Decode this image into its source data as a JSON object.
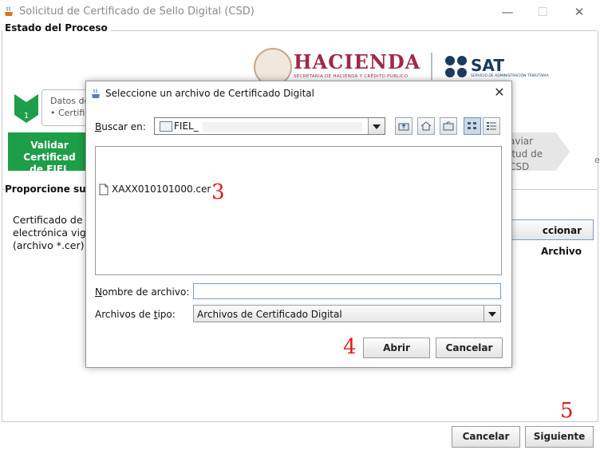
{
  "window": {
    "title": "Solicitud de Certificado de Sello Digital (CSD)",
    "minimize": "—",
    "maximize": "☐",
    "close": "✕"
  },
  "main": {
    "process_header": "Estado del Proceso",
    "logo_hacienda": "HACIENDA",
    "logo_hacienda_sub": "SECRETARÍA DE HACIENDA Y CRÉDITO PÚBLICO",
    "logo_sat": "SAT",
    "logo_sat_sub": "SERVICIO DE ADMINISTRACIÓN TRIBUTARIA",
    "step_number": "1",
    "step_info_line1": "Datos de",
    "step_info_line2": "•  Certifi",
    "green_step_line1": "Validar Certificad",
    "green_step_line2": "de FIEL Vigente",
    "gray_step_line1": "aviar",
    "gray_step_line2": "itud de",
    "gray_step_line3": "CSD",
    "edge_letter": "e",
    "provide_header": "Proporcione su ce",
    "cert_label_line1": "Certificado de fi",
    "cert_label_line2": "electrónica vige",
    "cert_label_line3": "(archivo *.cer)",
    "select_file_button": "ccionar Archivo",
    "cancel_button": "Cancelar",
    "next_button": "Siguiente",
    "annotation_5": "5"
  },
  "dialog": {
    "title": "Seleccione un archivo de Certificado Digital",
    "close": "✕",
    "look_in_label": "Buscar en:",
    "look_in_value": "FIEL_",
    "files": [
      "XAXX010101000.cer"
    ],
    "annotation_3": "3",
    "file_name_label": "Nombre de archivo:",
    "file_name_value": "",
    "file_type_label": "Archivos de tipo:",
    "file_type_value": "Archivos de Certificado Digital",
    "annotation_4": "4",
    "open_button": "Abrir",
    "cancel_button": "Cancelar"
  },
  "colors": {
    "green_step": "#1d9e48",
    "hacienda": "#9e2a47",
    "sat": "#1b3a5f",
    "annotation": "#e21b1b"
  }
}
